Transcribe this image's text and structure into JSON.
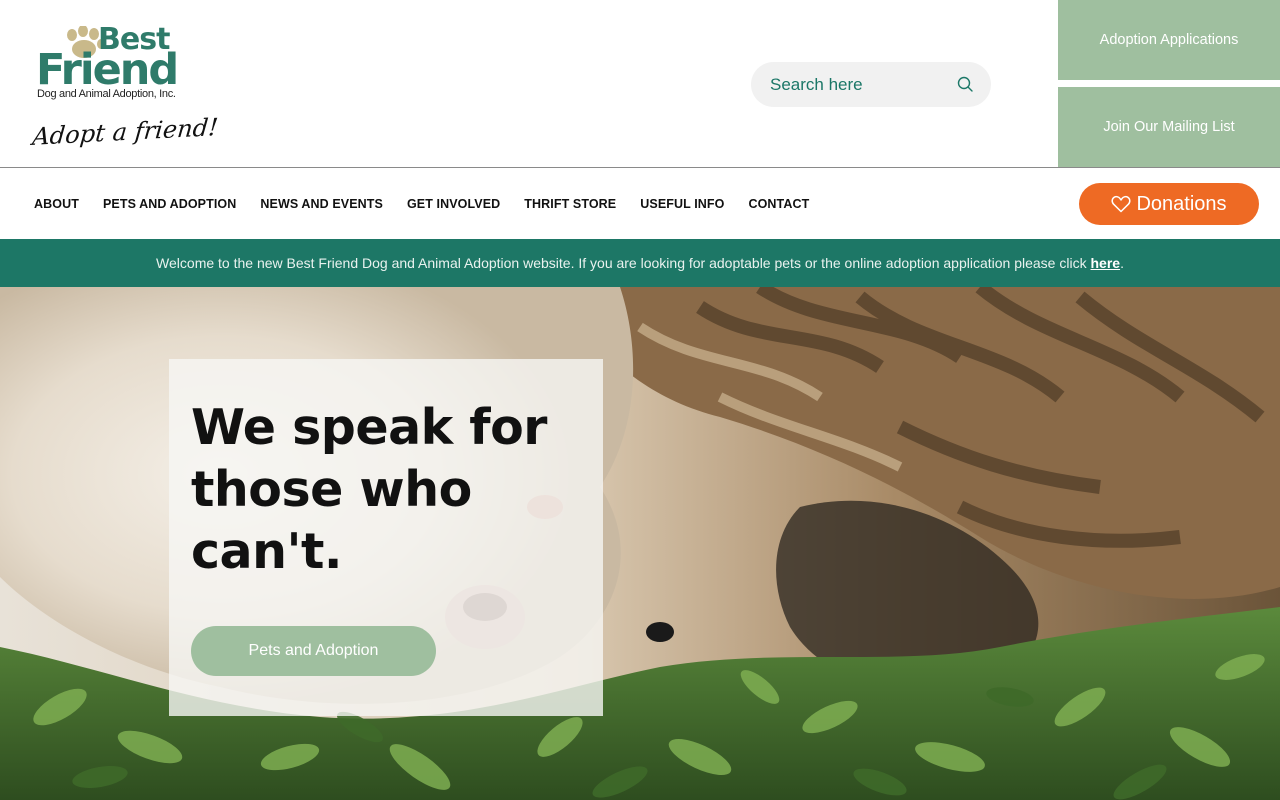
{
  "header": {
    "logo": {
      "line1": "Best",
      "line2": "Friend",
      "tagline": "Dog and Animal Adoption, Inc.",
      "script": "Adopt a friend!"
    },
    "search": {
      "placeholder": "Search here",
      "icon": "search-icon"
    },
    "adoption_applications": "Adoption Applications",
    "mailing_list": "Join Our Mailing List"
  },
  "nav": {
    "items": [
      {
        "label": "ABOUT"
      },
      {
        "label": "PETS AND ADOPTION"
      },
      {
        "label": "NEWS AND EVENTS"
      },
      {
        "label": "GET INVOLVED"
      },
      {
        "label": "THRIFT STORE"
      },
      {
        "label": "USEFUL INFO"
      },
      {
        "label": "CONTACT"
      }
    ],
    "donations_label": "Donations",
    "donations_icon": "heart-icon"
  },
  "banner": {
    "text": "Welcome to the new Best Friend Dog and Animal Adoption website. If you are looking for adoptable pets or the online adoption application please click ",
    "link": "here",
    "suffix": "."
  },
  "hero": {
    "title": "We speak for those who can't.",
    "cta": "Pets and Adoption"
  },
  "colors": {
    "brand_green": "#1d7766",
    "sage": "#9fbf9f",
    "donate_orange": "#ee6a24"
  }
}
